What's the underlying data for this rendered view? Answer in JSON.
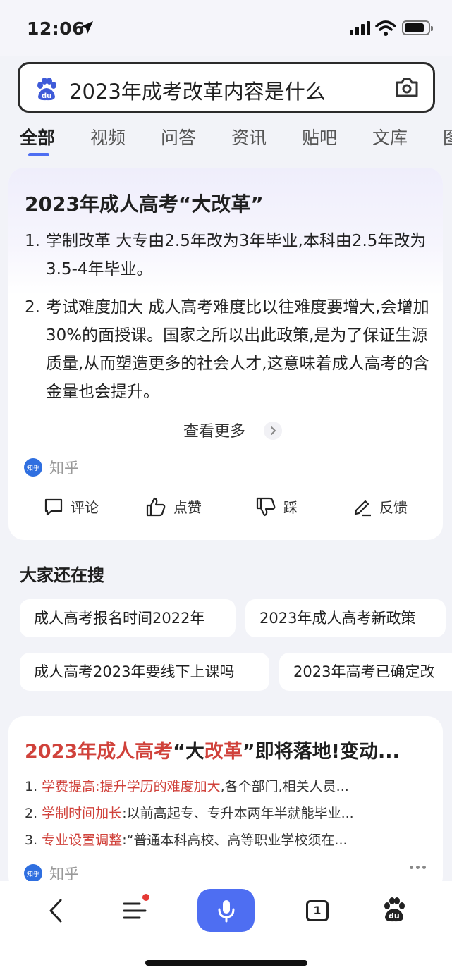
{
  "status": {
    "time": "12:06"
  },
  "search": {
    "query": "2023年成考改革内容是什么",
    "logo_icon": "baidu-paw-icon",
    "camera_icon": "camera-icon"
  },
  "tabs": [
    {
      "label": "全部",
      "active": true
    },
    {
      "label": "视频",
      "active": false
    },
    {
      "label": "问答",
      "active": false
    },
    {
      "label": "资讯",
      "active": false
    },
    {
      "label": "贴吧",
      "active": false
    },
    {
      "label": "文库",
      "active": false
    },
    {
      "label": "图",
      "active": false
    }
  ],
  "answer_card": {
    "title": "2023年成人高考“大改革”",
    "items": [
      {
        "num": "1.",
        "text": "学制改革 大专由2.5年改为3年毕业,本科由2.5年改为3.5-4年毕业。"
      },
      {
        "num": "2.",
        "text": "考试难度加大 成人高考难度比以往难度要增大,会增加30%的面授课。国家之所以出此政策,是为了保证生源质量,从而塑造更多的社会人才,这意味着成人高考的含金量也会提升。"
      }
    ],
    "more_label": "查看更多",
    "source_badge": "知乎",
    "source_name": "知乎",
    "actions": {
      "comment": "评论",
      "like": "点赞",
      "dislike": "踩",
      "feedback": "反馈"
    }
  },
  "related": {
    "title": "大家还在搜",
    "chips": [
      "成人高考报名时间2022年",
      "2023年成人高考新政策",
      "成人高考2023年要线下上课吗",
      "2023年高考已确定改"
    ]
  },
  "result_card": {
    "title_parts": [
      "2023年成人高考",
      "“大",
      "改革",
      "”即将落地!变动..."
    ],
    "items": [
      {
        "num": "1. ",
        "highlight": "学费提高:提升学历的难度加大",
        "rest": ",各个部门,相关人员..."
      },
      {
        "num": "2. ",
        "highlight": "学制时间加长",
        "rest": ":以前高起专、专升本两年半就能毕业..."
      },
      {
        "num": "3. ",
        "highlight": "专业设置调整",
        "rest": ":“普通本科高校、高等职业学校须在..."
      }
    ],
    "source_badge": "知乎",
    "source_name": "知乎"
  },
  "bottom_bar": {
    "tab_count": "1"
  },
  "colors": {
    "accent": "#4e6ef2",
    "highlight_red": "#d0423b",
    "zhihu_blue": "#2f6fe0"
  }
}
